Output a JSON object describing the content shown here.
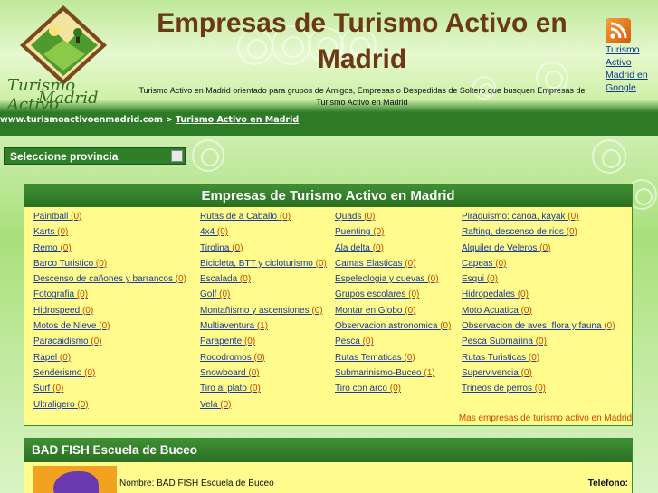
{
  "header": {
    "logo_line1": "Turismo Activo",
    "logo_line2": "Madrid",
    "title": "Empresas de Turismo Activo en Madrid",
    "tagline": "Turismo Activo en Madrid orientado para grupos de Amigos, Empresas o Despedidas de Soltero que busquen Empresas de Turismo Activo en Madrid",
    "rss_link": "Turismo Activo Madrid en Google"
  },
  "breadcrumb": {
    "root": "www.turismoactivoenmadrid.com",
    "separator": ">",
    "current": "Turismo Activo en Madrid"
  },
  "province_select": {
    "label": "Seleccione provincia"
  },
  "categories_panel": {
    "title": "Empresas de Turismo Activo en Madrid",
    "rows": [
      [
        {
          "name": "Paintball",
          "count": "(0)"
        },
        {
          "name": "Rutas de a Caballo",
          "count": "(0)"
        },
        {
          "name": "Quads",
          "count": "(0)"
        },
        {
          "name": "Piraguismo: canoa, kayak",
          "count": "(0)"
        }
      ],
      [
        {
          "name": "Karts",
          "count": "(0)"
        },
        {
          "name": "4x4",
          "count": "(0)"
        },
        {
          "name": "Puenting",
          "count": "(0)"
        },
        {
          "name": "Rafting, descenso de rios",
          "count": "(0)"
        }
      ],
      [
        {
          "name": "Remo",
          "count": "(0)"
        },
        {
          "name": "Tirolina",
          "count": "(0)"
        },
        {
          "name": "Ala delta",
          "count": "(0)"
        },
        {
          "name": "Alquiler de Veleros",
          "count": "(0)"
        }
      ],
      [
        {
          "name": "Barco Turistico",
          "count": "(0)"
        },
        {
          "name": "Bicicleta, BTT y cicloturismo",
          "count": "(0)"
        },
        {
          "name": "Camas Elasticas",
          "count": "(0)"
        },
        {
          "name": "Capeas",
          "count": "(0)"
        }
      ],
      [
        {
          "name": "Descenso de cañones y barrancos",
          "count": "(0)"
        },
        {
          "name": "Escalada",
          "count": "(0)"
        },
        {
          "name": "Espeleologia y cuevas",
          "count": "(0)"
        },
        {
          "name": "Esqui",
          "count": "(0)"
        }
      ],
      [
        {
          "name": "Fotografia",
          "count": "(0)"
        },
        {
          "name": "Golf",
          "count": "(0)"
        },
        {
          "name": "Grupos escolares",
          "count": "(0)"
        },
        {
          "name": "Hidropedales",
          "count": "(0)"
        }
      ],
      [
        {
          "name": "Hidrospeed",
          "count": "(0)"
        },
        {
          "name": "Montañismo y ascensiones",
          "count": "(0)"
        },
        {
          "name": "Montar en Globo",
          "count": "(0)"
        },
        {
          "name": "Moto Acuatica",
          "count": "(0)"
        }
      ],
      [
        {
          "name": "Motos de Nieve",
          "count": "(0)"
        },
        {
          "name": "Multiaventura",
          "count": "(1)"
        },
        {
          "name": "Observacion astronomica",
          "count": "(0)"
        },
        {
          "name": "Observacion de aves, flora y fauna",
          "count": "(0)"
        }
      ],
      [
        {
          "name": "Paracaidismo",
          "count": "(0)"
        },
        {
          "name": "Parapente",
          "count": "(0)"
        },
        {
          "name": "Pesca",
          "count": "(0)"
        },
        {
          "name": "Pesca Submarina",
          "count": "(0)"
        }
      ],
      [
        {
          "name": "Rapel",
          "count": "(0)"
        },
        {
          "name": "Rocodromos",
          "count": "(0)"
        },
        {
          "name": "Rutas Tematicas",
          "count": "(0)"
        },
        {
          "name": "Rutas Turisticas",
          "count": "(0)"
        }
      ],
      [
        {
          "name": "Senderismo",
          "count": "(0)"
        },
        {
          "name": "Snowboard",
          "count": "(0)"
        },
        {
          "name": "Submarinismo-Buceo",
          "count": "(1)"
        },
        {
          "name": "Supervivencia",
          "count": "(0)"
        }
      ],
      [
        {
          "name": "Surf",
          "count": "(0)"
        },
        {
          "name": "Tiro al plato",
          "count": "(0)"
        },
        {
          "name": "Tiro con arco",
          "count": "(0)"
        },
        {
          "name": "Trineos de perros",
          "count": "(0)"
        }
      ],
      [
        {
          "name": "Ultraligero",
          "count": "(0)"
        },
        {
          "name": "Vela",
          "count": "(0)"
        }
      ]
    ],
    "more_link": "Mas empresas de turismo activo en Madrid"
  },
  "company": {
    "title": "BAD FISH Escuela de Buceo",
    "name_line": "Nombre: BAD FISH Escuela de Buceo",
    "phone_label": "Telefono:"
  },
  "colors": {
    "title_brown": "#6b3a14",
    "bar_green": "#2d7a27",
    "panel_yellow": "#fffb8c",
    "link_blue": "#1a3a9a",
    "count_orange": "#c84a00"
  }
}
